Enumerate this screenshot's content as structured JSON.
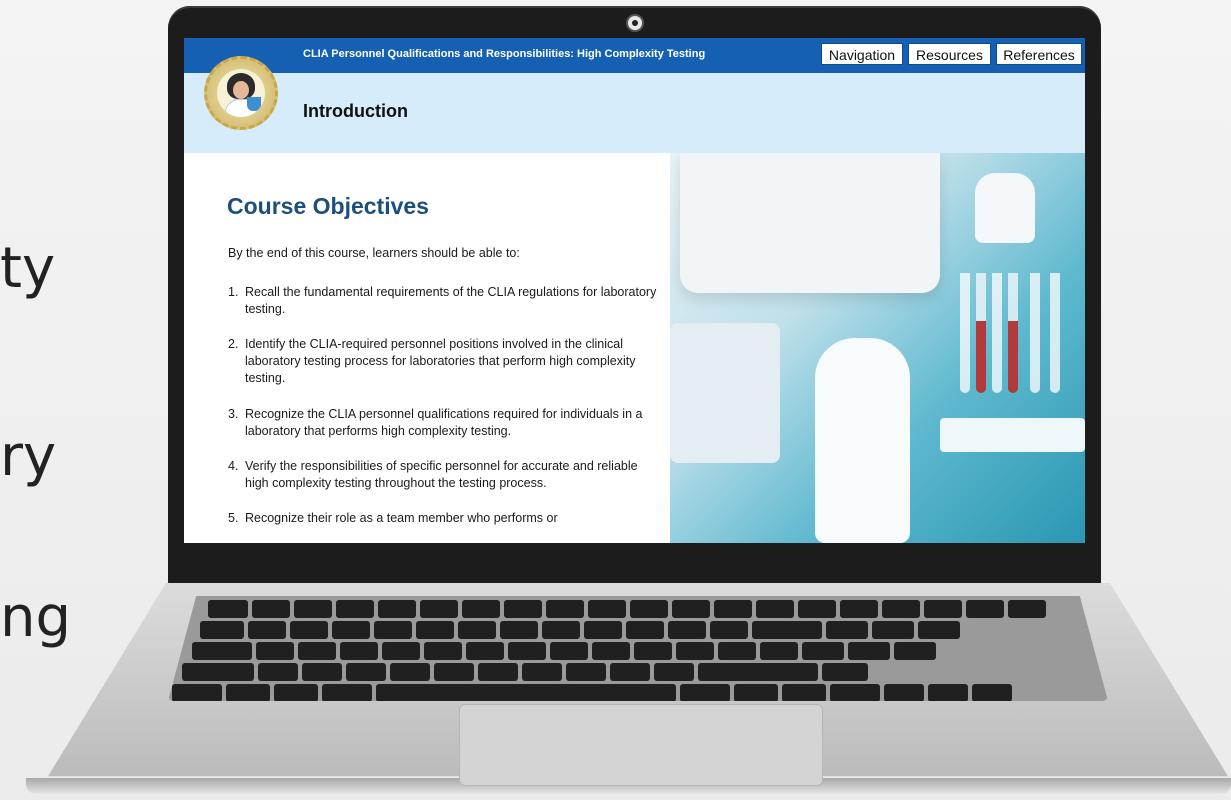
{
  "background_fragments": [
    "ty",
    "ry",
    "ng"
  ],
  "app": {
    "course_title": "CLIA Personnel Qualifications and Responsibilities: High Complexity Testing",
    "nav_buttons": [
      "Navigation",
      "Resources",
      "References"
    ],
    "section_title": "Introduction"
  },
  "page": {
    "heading": "Course Objectives",
    "intro": "By the end of this course, learners should be able to:",
    "objectives": [
      {
        "num": "1.",
        "text": "Recall the fundamental requirements of the CLIA regulations for laboratory testing."
      },
      {
        "num": "2.",
        "text": "Identify the CLIA-required personnel positions involved in the clinical laboratory testing process for laboratories that perform high complexity testing."
      },
      {
        "num": "3.",
        "text": "Recognize the CLIA personnel qualifications required for individuals in a laboratory that performs high complexity testing."
      },
      {
        "num": "4.",
        "text": "Verify the responsibilities of specific personnel for accurate and reliable high complexity testing throughout the testing process."
      },
      {
        "num": "5.",
        "text": "Recognize their role as a team member who performs or"
      }
    ]
  },
  "colors": {
    "topbar": "#1560b3",
    "subbar": "#d7ecfb",
    "heading": "#1b4f7d"
  }
}
